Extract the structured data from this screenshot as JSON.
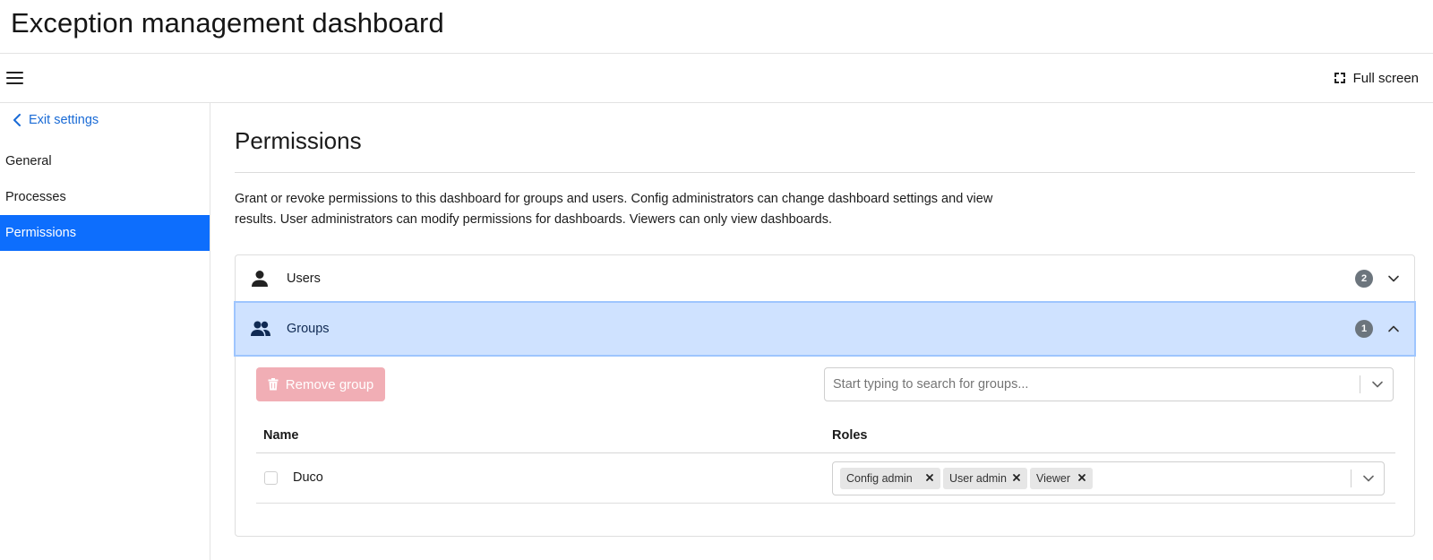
{
  "app": {
    "title": "Exception management dashboard"
  },
  "toolbar": {
    "menu_icon": "hamburger-menu-icon",
    "fullscreen_label": "Full screen",
    "fullscreen_icon": "fullscreen-icon"
  },
  "sidebar": {
    "exit_label": "Exit settings",
    "items": [
      {
        "label": "General",
        "active": false
      },
      {
        "label": "Processes",
        "active": false
      },
      {
        "label": "Permissions",
        "active": true
      }
    ]
  },
  "main": {
    "title": "Permissions",
    "description": "Grant or revoke permissions to this dashboard for groups and users. Config administrators can change dashboard settings and view results. User administrators can modify permissions for dashboards. Viewers can only view dashboards."
  },
  "accordion": {
    "users": {
      "label": "Users",
      "count": "2",
      "icon": "person-icon",
      "expanded": false
    },
    "groups": {
      "label": "Groups",
      "count": "1",
      "icon": "people-icon",
      "expanded": true
    }
  },
  "groups_panel": {
    "remove_button_label": "Remove group",
    "remove_button_disabled": true,
    "search_placeholder": "Start typing to search for groups...",
    "columns": [
      "Name",
      "Roles"
    ],
    "rows": [
      {
        "name": "Duco",
        "checked": false,
        "roles": [
          "Config admin",
          "User admin",
          "Viewer"
        ]
      }
    ]
  },
  "colors": {
    "accent": "#0d6efd",
    "link": "#1a6bd6",
    "selected_row": "#cfe2ff",
    "danger_disabled": "#f1aeb5",
    "badge": "#6c757d"
  }
}
